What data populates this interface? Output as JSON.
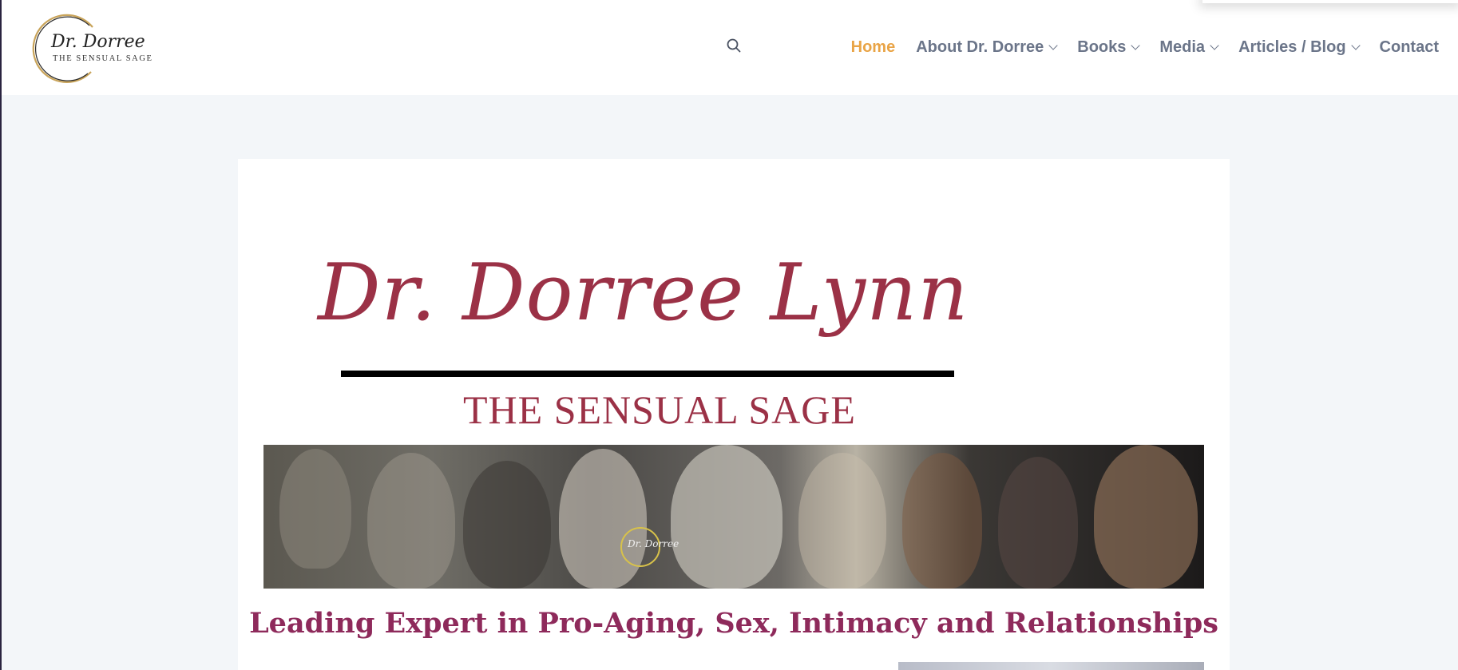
{
  "header": {
    "logo": {
      "script_text": "Dr. Dorree",
      "tagline": "THE SENSUAL SAGE"
    },
    "search_icon": "search-icon",
    "nav": [
      {
        "label": "Home",
        "active": true,
        "has_dropdown": false
      },
      {
        "label": "About Dr. Dorree",
        "active": false,
        "has_dropdown": true
      },
      {
        "label": "Books",
        "active": false,
        "has_dropdown": true
      },
      {
        "label": "Media",
        "active": false,
        "has_dropdown": true
      },
      {
        "label": "Articles / Blog",
        "active": false,
        "has_dropdown": true
      },
      {
        "label": "Contact",
        "active": false,
        "has_dropdown": false
      }
    ]
  },
  "hero": {
    "title": "Dr. Dorree Lynn",
    "subtitle": "THE SENSUAL SAGE",
    "banner_logo_text": "Dr. Dorree"
  },
  "tagline": "Leading Expert in Pro-Aging, Sex, Intimacy and Relationships",
  "colors": {
    "nav_active": "#e9a446",
    "nav_default": "#6b7589",
    "hero": "#9b3146",
    "tagline": "#8e2a5b",
    "page_bg": "#f3f6f9"
  }
}
